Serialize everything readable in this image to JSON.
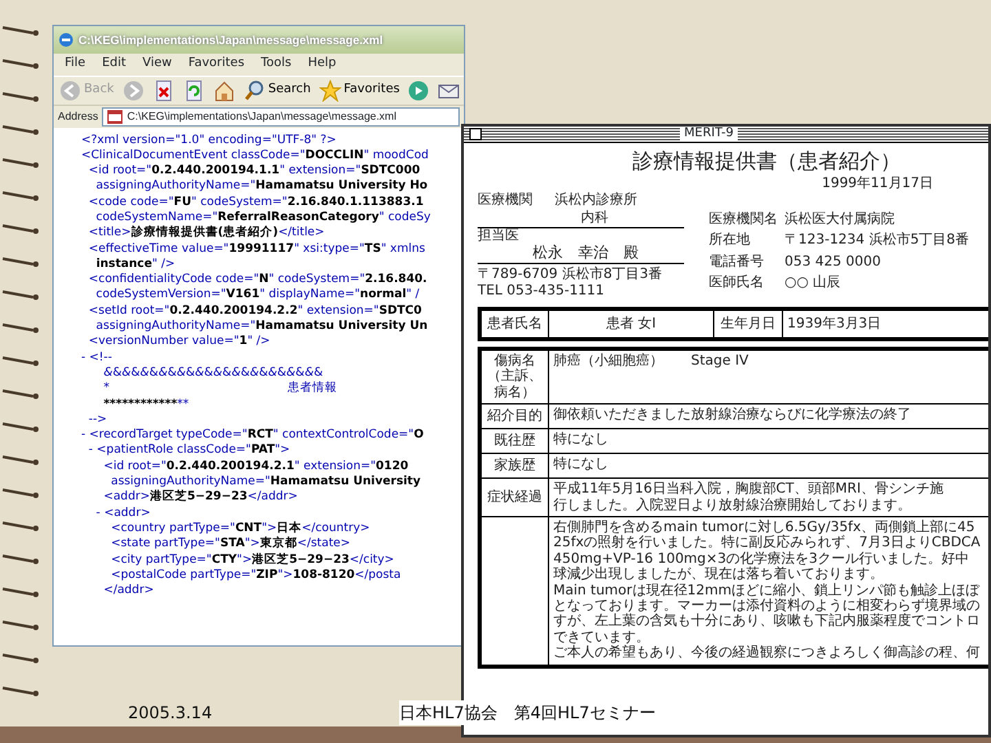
{
  "slide": {
    "footer_date": "2005.3.14",
    "footer_title": "日本HL7協会　第4回HL7セミナー"
  },
  "browser": {
    "title": "C:\\KEG\\implementations\\Japan\\message\\message.xml",
    "menu": [
      "File",
      "Edit",
      "View",
      "Favorites",
      "Tools",
      "Help"
    ],
    "toolbar": [
      {
        "kind": "back",
        "label": "Back",
        "disabled": true
      },
      {
        "kind": "forward",
        "disabled": true
      },
      {
        "kind": "stop"
      },
      {
        "kind": "refresh"
      },
      {
        "kind": "home"
      },
      {
        "kind": "search",
        "label": "Search"
      },
      {
        "kind": "favorites",
        "label": "Favorites"
      },
      {
        "kind": "media"
      },
      {
        "kind": "mail"
      }
    ],
    "address_label": "Address",
    "address": "C:\\KEG\\implementations\\Japan\\message\\message.xml",
    "xml_lines": [
      "<?xml version=\"1.0\" encoding=\"UTF-8\" ?>",
      "<ClinicalDocumentEvent classCode=\"**DOCCLIN**\" moodCod",
      "  <id root=\"**0.2.440.200194.1.1**\" extension=\"**SDTC000**",
      "    assigningAuthorityName=\"**Hamamatsu University Ho**",
      "  <code code=\"**FU**\" codeSystem=\"**2.16.840.1.113883.1**",
      "    codeSystemName=\"**ReferralReasonCategory**\" codeSy",
      "  <title>**診療情報提供書(患者紹介)**</title>",
      "  <effectiveTime value=\"**19991117**\" xsi:type=\"**TS**\" xmlns",
      "    **instance**\" />",
      "  <confidentialityCode code=\"**N**\" codeSystem=\"**2.16.840.**",
      "    codeSystemVersion=\"**V161**\" displayName=\"**normal**\" /",
      "  <setId root=\"**0.2.440.200194.2.2**\" extension=\"**SDTC0**",
      "    assigningAuthorityName=\"**Hamamatsu University Un**",
      "  <versionNumber value=\"**1**\" />",
      "- <!--",
      "      *&*&*&*&*&*&*&*&*&*&*&*&*&*&*&*&*&*&*&*&*&*&*&*&",
      "      *                                                患者情報",
      "      **************************************************************",
      "  -->",
      "- <recordTarget typeCode=\"**RCT**\" contextControlCode=\"**O**",
      "  - <patientRole classCode=\"**PAT**\">",
      "      <id root=\"**0.2.440.200194.2.1**\" extension=\"**0120**",
      "        assigningAuthorityName=\"**Hamamatsu University**",
      "      <addr>**港区芝5−29−23**</addr>",
      "    - <addr>",
      "        <country partType=\"**CNT**\">**日本**</country>",
      "        <state partType=\"**STA**\">**東京都**</state>",
      "        <city partType=\"**CTY**\">**港区芝5−29−23**</city>",
      "        <postalCode partType=\"**ZIP**\">**108-8120**</posta",
      "      </addr>"
    ]
  },
  "document_window": {
    "title": "MERIT-9",
    "doc_title": "診療情報提供書（患者紹介）",
    "date": "1999年11月17日",
    "to": {
      "institution_label": "医療機関",
      "institution": "浜松内診療所",
      "department": "内科",
      "doctor_label": "担当医",
      "doctor": "松永　幸治　殿",
      "address": "〒789-6709 浜松市8丁目3番",
      "tel": "TEL 053-435-1111"
    },
    "from": [
      {
        "label": "医療機関名",
        "value": "浜松医大付属病院"
      },
      {
        "label": "所在地",
        "value": "〒123-1234 浜松市5丁目8番"
      },
      {
        "label": "電話番号",
        "value": "053 425 0000"
      },
      {
        "label": "医師氏名",
        "value": "○○ 山辰"
      }
    ],
    "patient": {
      "name_label": "患者氏名",
      "name": "患者 女I",
      "birth_label": "生年月日",
      "birth": "1939年3月3日"
    },
    "rows": [
      {
        "label_lines": [
          "傷病名",
          "（主訴、",
          "病名）"
        ],
        "lines": [
          "肺癌（小細胞癌）　　Stage IV"
        ]
      },
      {
        "label_lines": [
          "紹介目的"
        ],
        "lines": [
          "御依頼いただきました放射線治療ならびに化学療法の終了"
        ]
      },
      {
        "label_lines": [
          "既往歴"
        ],
        "lines": [
          "特になし"
        ]
      },
      {
        "label_lines": [
          "家族歴"
        ],
        "lines": [
          "特になし"
        ]
      },
      {
        "label_lines": [
          "症状経過"
        ],
        "lines": [
          "平成11年5月16日当科入院，胸腹部CT、頭部MRI、骨シンチ施",
          "行しました。入院翌日より放射線治療開始しております。"
        ]
      },
      {
        "lines": [
          "右側肺門を含めるmain tumorに対し6.5Gy/35fx、両側鎖上部に45",
          "25fxの照射を行いました。特に副反応みられず、7月3日よりCBDCA",
          "450mg+VP-16 100mg×3の化学療法を3クール行いました。好中",
          "球減少出現しましたが、現在は落ち着いております。",
          "Main tumorは現在径12mmほどに縮小、鎖上リンパ節も触診上ほぼ",
          "となっております。マーカーは添付資料のように相変わらず境界域の",
          "すが、左上葉の含気も十分にあり、咳嗽も下記内服薬程度でコントロ",
          "できています。",
          "ご本人の希望もあり、今後の経過観察につきよろしく御高診の程、何"
        ]
      }
    ]
  }
}
